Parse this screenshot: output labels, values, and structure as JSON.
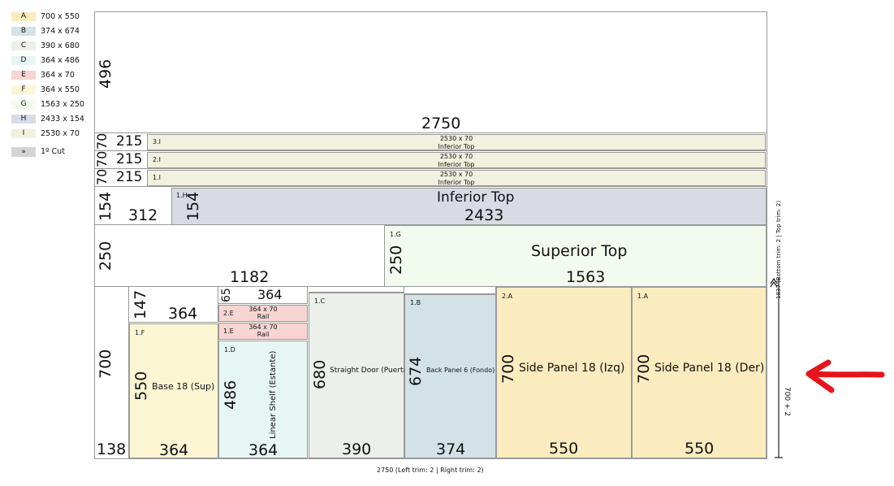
{
  "legend": [
    {
      "code": "A",
      "size": "700 x 550",
      "color": "#fbecbf"
    },
    {
      "code": "B",
      "size": "374 x 674",
      "color": "#d2e2e6"
    },
    {
      "code": "C",
      "size": "390 x 680",
      "color": "#ebf0ea"
    },
    {
      "code": "D",
      "size": "364 x 486",
      "color": "#e6f6f3"
    },
    {
      "code": "E",
      "size": "364 x 70",
      "color": "#f6d5d2"
    },
    {
      "code": "F",
      "size": "364 x 550",
      "color": "#fcf6d4"
    },
    {
      "code": "G",
      "size": "1563 x 250",
      "color": "#f3fbef"
    },
    {
      "code": "H",
      "size": "2433 x 154",
      "color": "#d8dbe4"
    },
    {
      "code": "I",
      "size": "2530 x 70",
      "color": "#f2f0de"
    }
  ],
  "cut_button": "»",
  "cut_label": "1º Cut",
  "sheet": {
    "width_label": "2750 (Left trim: 2  | Right trim: 2)",
    "height_label": "1837 (Bottom trim: 2  | Top trim: 2)",
    "selected_label": "700 + 2"
  },
  "top_waste": {
    "height": "496",
    "width": "2750"
  },
  "strips": [
    {
      "h": "70",
      "w": "215",
      "id": "3.I",
      "size": "2530 x 70",
      "name": "Inferior Top"
    },
    {
      "h": "70",
      "w": "215",
      "id": "2.I",
      "size": "2530 x 70",
      "name": "Inferior Top"
    },
    {
      "h": "70",
      "w": "215",
      "id": "1.I",
      "size": "2530 x 70",
      "name": "Inferior Top"
    }
  ],
  "row_h": {
    "waste_h": "154",
    "waste_w": "312",
    "id": "1.H",
    "h": "154",
    "name": "Inferior Top",
    "w": "2433"
  },
  "row_g": {
    "waste_h": "250",
    "waste_w": "1182",
    "id": "1.G",
    "h": "250",
    "name": "Superior Top",
    "w": "1563"
  },
  "bottom": {
    "waste": {
      "h": "700",
      "w": "138"
    },
    "col_f": {
      "top_h": "147",
      "top_w": "364",
      "id": "1.F",
      "h": "550",
      "name": "Base 18 (Sup)",
      "w": "364"
    },
    "col_e": {
      "top_h": "65",
      "top_w": "364",
      "rails": [
        {
          "id": "2.E",
          "size": "364 x 70",
          "name": "Rail"
        },
        {
          "id": "1.E",
          "size": "364 x 70",
          "name": "Rail"
        }
      ],
      "id": "1.D",
      "h": "486",
      "name": "Linear Shelf (Estante)",
      "w": "364"
    },
    "col_c": {
      "id": "1.C",
      "h": "680",
      "name": "Straight Door (Puerta)",
      "w": "390"
    },
    "col_b": {
      "id": "1.B",
      "h": "674",
      "name": "Back Panel 6 (Fondo)",
      "w": "374"
    },
    "col_a2": {
      "id": "2.A",
      "h": "700",
      "name": "Side Panel 18 (Izq)",
      "w": "550"
    },
    "col_a1": {
      "id": "1.A",
      "h": "700",
      "name": "Side Panel 18 (Der)",
      "w": "550"
    }
  },
  "colors": {
    "arrow": "#e8141b",
    "border": "#999999"
  }
}
